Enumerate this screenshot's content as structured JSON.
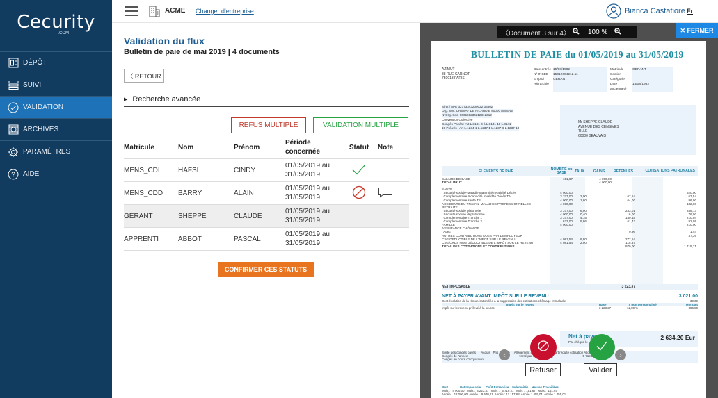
{
  "brand": {
    "logo_text": "Cecurity",
    "logo_sub": ".COM"
  },
  "sidebar": {
    "items": [
      {
        "label": "DÉPÔT",
        "icon": "deposit-icon"
      },
      {
        "label": "SUIVI",
        "icon": "tracking-icon"
      },
      {
        "label": "VALIDATION",
        "icon": "check-circle-icon",
        "active": true
      },
      {
        "label": "ARCHIVES",
        "icon": "archive-icon"
      },
      {
        "label": "PARAMÈTRES",
        "icon": "gear-icon"
      },
      {
        "label": "AIDE",
        "icon": "help-icon"
      }
    ]
  },
  "topbar": {
    "company": "ACME",
    "separator": "|",
    "change_company": "Changer d'entreprise",
    "user": "Bianca Castafiore",
    "lang": "Fr"
  },
  "main": {
    "title": "Validation du flux",
    "subtitle": "Bulletin de paie de mai 2019 | 4 documents",
    "back": "〈 RETOUR",
    "advanced_search": "Recherche avancée",
    "refus_multiple": "REFUS MULTIPLE",
    "validation_multiple": "VALIDATION MULTIPLE",
    "confirm": "CONFIRMER CES STATUTS",
    "columns": [
      "Matricule",
      "Nom",
      "Prénom",
      "Période concernée",
      "Statut",
      "Note"
    ],
    "rows": [
      {
        "matricule": "MENS_CDI",
        "nom": "HAFSI",
        "prenom": "CINDY",
        "periode": "01/05/2019 au 31/05/2019",
        "statut": "validated"
      },
      {
        "matricule": "MENS_CDD",
        "nom": "BARRY",
        "prenom": "ALAIN",
        "periode": "01/05/2019 au 31/05/2019",
        "statut": "refused",
        "note": true
      },
      {
        "matricule": "GERANT",
        "nom": "SHEPPE",
        "prenom": "CLAUDE",
        "periode": "01/05/2019 au 31/05/2019",
        "selected": true
      },
      {
        "matricule": "APPRENTI",
        "nom": "ABBOT",
        "prenom": "PASCAL",
        "periode": "01/05/2019 au 31/05/2019"
      }
    ]
  },
  "viewer": {
    "document": "〈Document 3 sur 4〉",
    "zoom": "100 %",
    "close": "✕ FERMER",
    "refuse_tip": "Refuser",
    "valid_tip": "Valider"
  },
  "payslip": {
    "title": "BULLETIN DE PAIE du 01/05/2019 au 31/05/2019",
    "employer_lines": [
      "AZIMUT",
      "38 RUE CARNOT",
      "750013 PARIS"
    ],
    "info": [
      [
        "Date entrée",
        "15/08/1982",
        "Matricule",
        "GERANT"
      ],
      [
        "N° INSEE",
        "15012604212.11",
        "Section",
        ""
      ],
      [
        "Emploi",
        "GERANT",
        "Catégorie",
        ""
      ],
      [
        "Hiérarchie",
        "",
        "Date ancienneté",
        "15/08/1982"
      ]
    ],
    "left_lines": [
      "Siret / APE  32773343200022  3630Z",
      "Org. Soc.  URSSAF DE PICARDIE",
      "                80000  AMIENS",
      "N°Org. Soc.  806581234212312312",
      "Convention Collective",
      "Congés Payés : Art L.3141-3 à L.3141-11 L.3141-",
      "19   Préavis : Art L.1234-1 L.1237-1 L.1237-6",
      "L.1237-10"
    ],
    "address_lines": [
      "Mr  SHEPPE CLAUDE",
      "AVENUE DES CENSIVES",
      "TILLE",
      "60000  BEAUVAIS"
    ],
    "head": [
      "ELEMENTS DE PAIE",
      "NOMBRE ou BASE",
      "TAUX",
      "GAINS",
      "RETENUES",
      "COTISATIONS PATRONALES"
    ],
    "lines": [
      [
        "SALAIRE DE BASE",
        "151,67",
        "",
        "4 000,00",
        "",
        ""
      ],
      [
        "TOTAL BRUT",
        "",
        "",
        "4 000,00",
        "",
        ""
      ],
      [
        "",
        "",
        "",
        "",
        "",
        ""
      ],
      [
        "SANTÉ",
        "",
        "",
        "",
        "",
        ""
      ],
      [
        "  Sécurité sociale-Maladie Maternité Invalidité Décès",
        "4 000,00",
        "",
        "",
        "",
        "520,00"
      ],
      [
        "  Complémentaire Incapacité Invalidité Décès TA",
        "3 377,00",
        "2,00",
        "",
        "67,54",
        "67,54"
      ],
      [
        "  Complémentaire santé TS",
        "4 000,00",
        "1,60",
        "",
        "64,00",
        "96,00"
      ],
      [
        "ACCIDENTS DU TRAVAIL-MALADIES PROFESSIONNELLES",
        "4 000,00",
        "",
        "",
        "",
        "132,00"
      ],
      [
        "RETRAITE",
        "",
        "",
        "",
        "",
        ""
      ],
      [
        "  Sécurité sociale plafonnée",
        "3 377,00",
        "6,90",
        "",
        "233,01",
        "288,73"
      ],
      [
        "  Sécurité sociale déplafonnée",
        "4 000,00",
        "0,40",
        "",
        "16,00",
        "76,00"
      ],
      [
        "  Complémentaire Tranche 1",
        "3 377,00",
        "4,15",
        "",
        "140,15",
        "210,04"
      ],
      [
        "  Complémentaire Tranche 2",
        "623,00",
        "9,86",
        "",
        "61,43",
        "92,09"
      ],
      [
        "FAMILLE",
        "4 000,00",
        "",
        "",
        "",
        "210,00"
      ],
      [
        "ASSURANCE CHÔMAGE",
        "",
        "",
        "",
        "",
        ""
      ],
      [
        "  Apec",
        "",
        "",
        "",
        "0,96",
        "1,44"
      ],
      [
        "AUTRES CONTRIBUTIONS DUES PAR L'EMPLOYEUR",
        "",
        "",
        "",
        "",
        "37,36"
      ],
      [
        "CSG DÉDUCTIBLE DE L'IMPÔT SUR LE REVENU",
        "4 081,54",
        "6,80",
        "",
        "277,54",
        ""
      ],
      [
        "CSG/CRDS NON DÉDUCTIBLE DE L'IMPÔT SUR LE REVENU",
        "4 081,54",
        "2,90",
        "",
        "118,37",
        ""
      ],
      [
        "TOTAL DES COTISATIONS ET CONTRIBUTIONS",
        "",
        "",
        "",
        "979,00",
        "1 719,21"
      ]
    ],
    "imposable_label": "NET IMPOSABLE",
    "imposable_value": "3 223,37",
    "net_avant_label": "NET À PAYER AVANT IMPÔT SUR LE REVENU",
    "net_avant_value": "3 021,00",
    "net_avant_sub1": "Dont évolution de la rémunération liée à la suppression des cotisations chômage et maladie",
    "net_avant_sub1_val": "-39,39",
    "impot_head": [
      "Impôt sur le revenu",
      "Base",
      "Tx non personnalisé",
      "Montant"
    ],
    "impot_row": [
      "Impôt sur le revenu prélevé à la source",
      "3 223,37",
      "12,00 %",
      "386,80"
    ],
    "net_label": "Net à payer",
    "net_sub": "Par chèque le : 31/05/2019",
    "net_value": "2 634,20 Eur",
    "conges_lines": [
      "Solde des congés payés      Acquis   Pris    Solde     Allègement de cotisations + part réduite cotisation Allocations familiales     0,00",
      "Congés de l'année                                                           versé par l'employeur (*)                                  5 719,21",
      "Congés en cours d'acquisition"
    ],
    "bottom_lines": [
      "Brut              Net Imposable      Coût Entreprise    Indemnités    Heures Travaillées",
      "Mois :   4 000,00   Mois :  3 223,37   Mois :   5 719,21   Mois :  151,67   Mois :  151,67",
      "Année :  12 000,00  Année :  9 670,11  Année : 17 157,63  Année :  455,01  Année :  455,01"
    ]
  },
  "colors": {
    "sidebar_bg": "#123b60",
    "sidebar_active": "#1e72b8",
    "accent_blue": "#1e5d93",
    "refuse_red": "#c0392b",
    "valid_green": "#27a243",
    "confirm_orange": "#e8741f",
    "payslip_teal": "#1f8fa3"
  }
}
